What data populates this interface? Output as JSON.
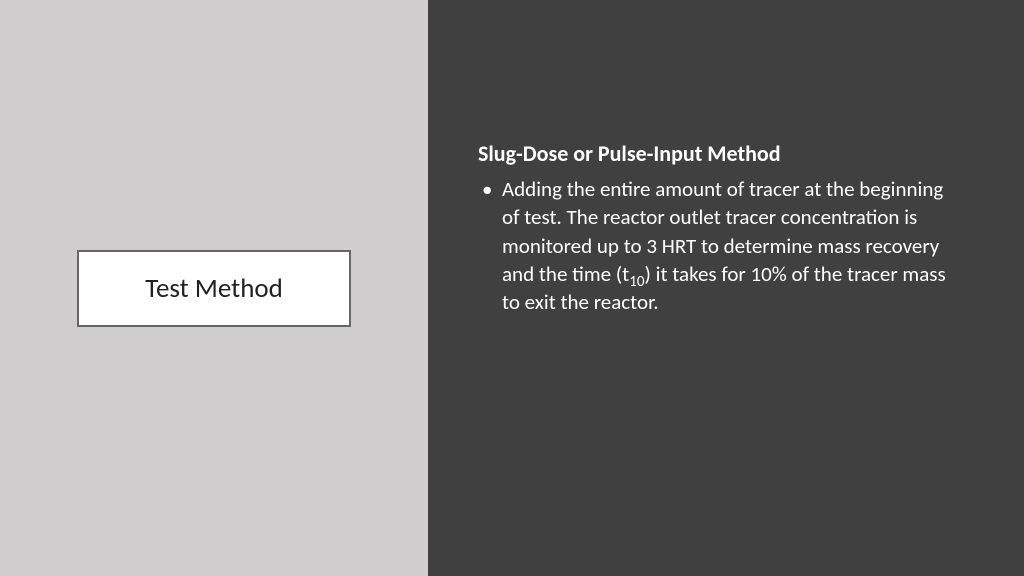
{
  "left": {
    "title": "Test Method"
  },
  "right": {
    "heading": "Slug-Dose or Pulse-Input Method",
    "bullet_pre": "Adding the entire amount of tracer at the beginning of test.  The reactor outlet tracer concentration is monitored up to 3 HRT to determine mass recovery and the time (t",
    "bullet_sub": "10",
    "bullet_post": ") it takes for 10% of the tracer mass to exit the reactor."
  }
}
